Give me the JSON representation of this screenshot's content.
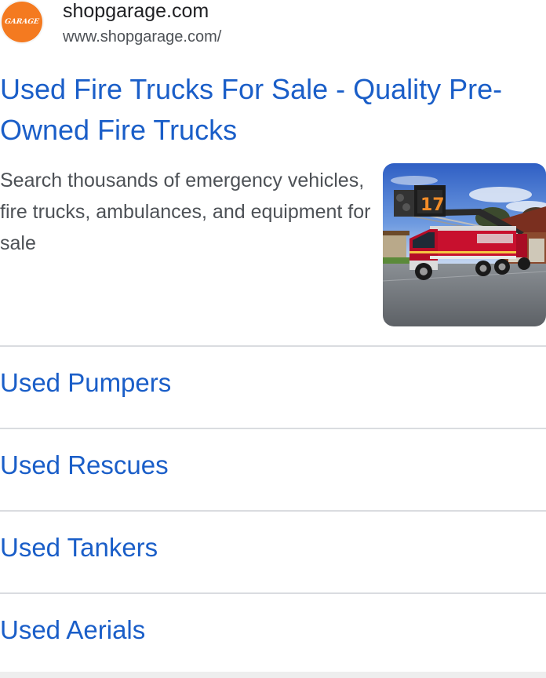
{
  "site": {
    "favicon_text": "GARAGE",
    "name": "shopgarage.com",
    "url": "www.shopgarage.com/"
  },
  "result": {
    "title": "Used Fire Trucks For Sale - Quality Pre-Owned Fire Trucks",
    "snippet": "Search thousands of emergency vehicles, fire trucks, ambulances, and equipment for sale",
    "thumbnail_alt": "red ladder fire truck parked in front of fire station"
  },
  "sitelinks": [
    {
      "label": "Used Pumpers"
    },
    {
      "label": "Used Rescues"
    },
    {
      "label": "Used Tankers"
    },
    {
      "label": "Used Aerials"
    }
  ],
  "colors": {
    "link": "#1a5ec8",
    "favicon": "#f47a20",
    "truck_red": "#c8102e",
    "divider": "#dadce0"
  }
}
